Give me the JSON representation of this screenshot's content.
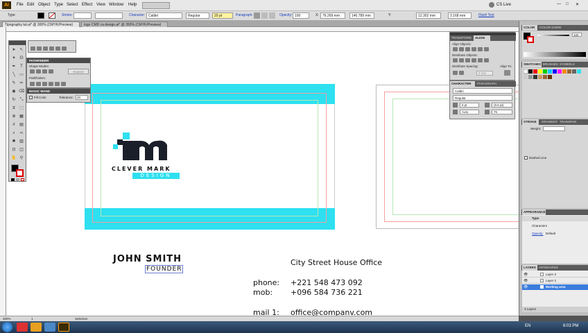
{
  "app": {
    "logo": "Ai",
    "menu": [
      "File",
      "Edit",
      "Object",
      "Type",
      "Select",
      "Effect",
      "View",
      "Window",
      "Help"
    ],
    "cs_live": "CS Live"
  },
  "control_bar": {
    "selection_type": "Type",
    "stroke_label": "Stroke:",
    "character_label": "Character:",
    "font": "Calibri",
    "style": "Regular",
    "size": "20 pt",
    "paragraph_label": "Paragraph:",
    "opacity_label": "Opacity:",
    "opacity": "100",
    "x": "76.269 mm",
    "y": "146.789 mm",
    "w": "12.302 mm",
    "h": "3.168 mm",
    "flash_text": "Flash Text"
  },
  "tabs": [
    {
      "label": "Tipography tut.ai* @ 300% (CMYK/Preview)"
    },
    {
      "label": "logo CMD ca design.ai* @ 350% (CMYK/Preview)"
    }
  ],
  "panels": {
    "pathfinder": {
      "title": "PATHFINDER",
      "shape_modes": "Shape Modes:",
      "pathfinders": "Pathfinders:",
      "expand": "Expand"
    },
    "magic_wand": {
      "title": "MAGIC WAND",
      "fill_color": "Fill Color",
      "tolerance_label": "Tolerance:",
      "tolerance": "20"
    },
    "align": {
      "tab1": "TRANSFORM",
      "tab2": "ALIGN",
      "align_objects": "Align Objects:",
      "distribute_objects": "Distribute Objects:",
      "distribute_spacing": "Distribute Spacing:",
      "align_to": "Align To:",
      "spacing": "0 mm"
    },
    "character": {
      "tab1": "CHARACTER",
      "tab2": "PARAGRAPH",
      "font": "Calibri",
      "style": "Regular",
      "size": "6 pt",
      "leading": "(9.6 pt)",
      "kerning": "Auto",
      "tracking": "75"
    },
    "color": {
      "tab1": "COLOR",
      "tab2": "COLOR GUIDE",
      "value": "100"
    },
    "swatches": {
      "tab1": "SWATCHES",
      "tab2": "BRUSHES",
      "tab3": "SYMBOLS"
    },
    "stroke": {
      "tab1": "STROKE",
      "tab2": "GRADIENT",
      "tab3": "TRANSPAR",
      "weight": "Weight:",
      "dashed": "Dashed Line"
    },
    "appearance": {
      "title": "APPEARANCE",
      "type": "Type",
      "characters": "Characters",
      "opacity_label": "Opacity:",
      "opacity": "Default"
    },
    "layers": {
      "tab1": "LAYERS",
      "tab2": "ARTBOARDS",
      "items": [
        "Layer 3",
        "Layer 2",
        "Working area"
      ],
      "count": "3 Layers"
    }
  },
  "artwork": {
    "logo_line1": "CLEVER MARK",
    "logo_line2": "DESIGN",
    "name": "JOHN SMITH",
    "role": "FOUNDER",
    "office": "City Street House Office",
    "phone_label": "phone:",
    "phone": "+221 548 473 092",
    "mob_label": "mob:",
    "mob": "+096 584 736 221",
    "mail_label": "mail 1:",
    "mail": "office@companv.com",
    "accent": "#2ee0f0"
  },
  "status": {
    "zoom": "300%",
    "page": "1",
    "mode": "Selection"
  },
  "taskbar": {
    "lang": "EN",
    "time": "8:03 PM"
  }
}
